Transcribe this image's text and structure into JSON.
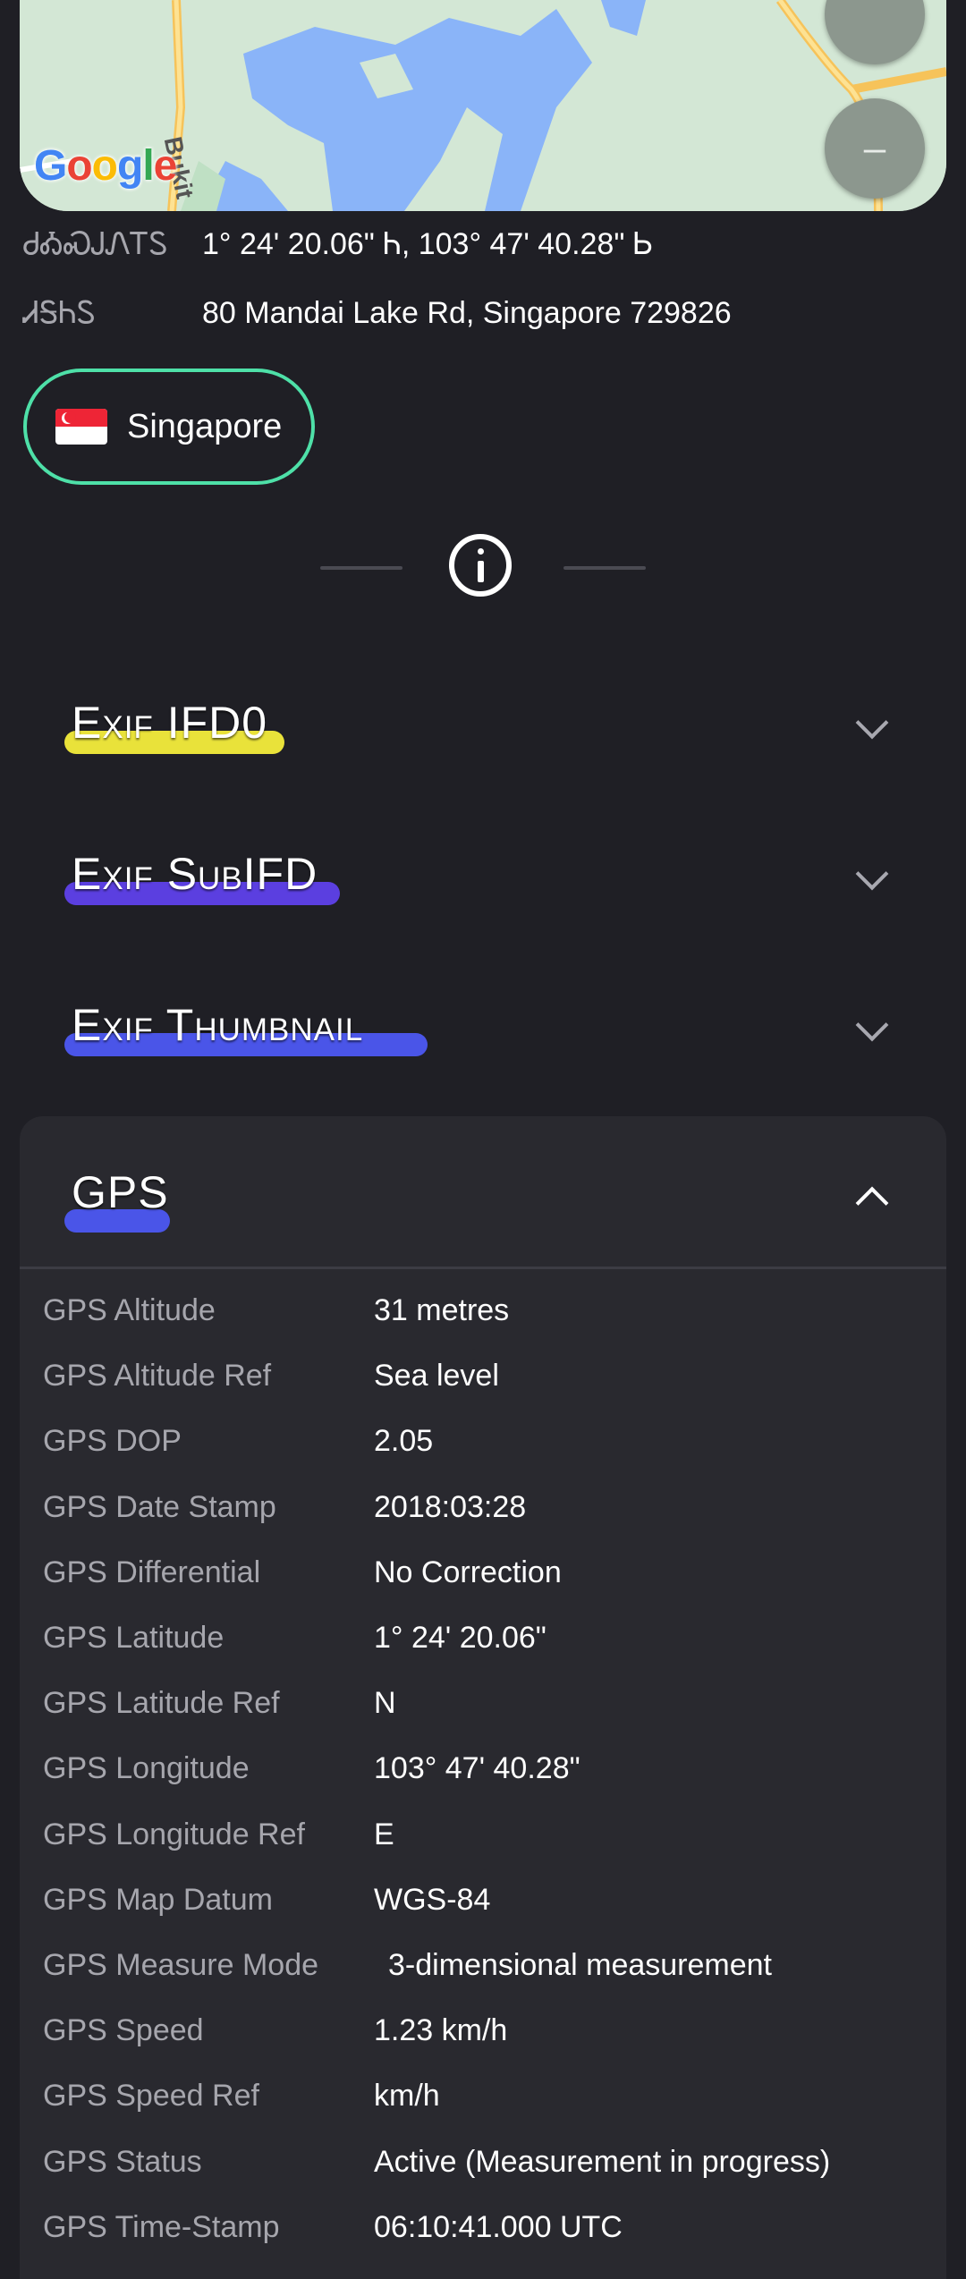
{
  "map": {
    "logo_letters": [
      {
        "char": "G",
        "color": "#4285F4"
      },
      {
        "char": "o",
        "color": "#EA4335"
      },
      {
        "char": "o",
        "color": "#FBBC05"
      },
      {
        "char": "g",
        "color": "#4285F4"
      },
      {
        "char": "l",
        "color": "#34A853"
      },
      {
        "char": "e",
        "color": "#EA4335"
      }
    ],
    "street_label": "Bukit",
    "zoom_out_label": "–"
  },
  "location": {
    "coords_label": "ᏧᎣᏍᎫᏁᎢᏚ",
    "coords_value": "1° 24' 20.06\" Ꮒ, 103° 47' 40.28\" Ꮟ",
    "address_label": "ᏗᎦᏂᏚ",
    "address_value": "80 Mandai Lake Rd, Singapore 729826",
    "country": "Singapore"
  },
  "sections": [
    {
      "title": "Exif IFD0",
      "highlight_color": "#e9e23a",
      "expanded": false
    },
    {
      "title": "Exif SubIFD",
      "highlight_color": "#5b3fe0",
      "expanded": false
    },
    {
      "title": "Exif Thumbnail",
      "highlight_color": "#4a55e8",
      "expanded": false
    },
    {
      "title": "GPS",
      "highlight_color": "#4a55e8",
      "expanded": true
    }
  ],
  "gps_rows": [
    {
      "label": "GPS Altitude",
      "value": "31 metres"
    },
    {
      "label": "GPS Altitude Ref",
      "value": "Sea level"
    },
    {
      "label": "GPS DOP",
      "value": "2.05"
    },
    {
      "label": "GPS Date Stamp",
      "value": "2018:03:28"
    },
    {
      "label": "GPS Differential",
      "value": "No Correction"
    },
    {
      "label": "GPS Latitude",
      "value": "1° 24' 20.06\""
    },
    {
      "label": "GPS Latitude Ref",
      "value": "N"
    },
    {
      "label": "GPS Longitude",
      "value": "103° 47' 40.28\""
    },
    {
      "label": "GPS Longitude Ref",
      "value": "E"
    },
    {
      "label": "GPS Map Datum",
      "value": "WGS-84"
    },
    {
      "label": "GPS Measure Mode",
      "value": "3-dimensional measurement"
    },
    {
      "label": "GPS Speed",
      "value": "1.23 km/h"
    },
    {
      "label": "GPS Speed Ref",
      "value": "km/h"
    },
    {
      "label": "GPS Status",
      "value": "Active (Measurement in progress)"
    },
    {
      "label": "GPS Time-Stamp",
      "value": "06:10:41.000 UTC"
    }
  ]
}
